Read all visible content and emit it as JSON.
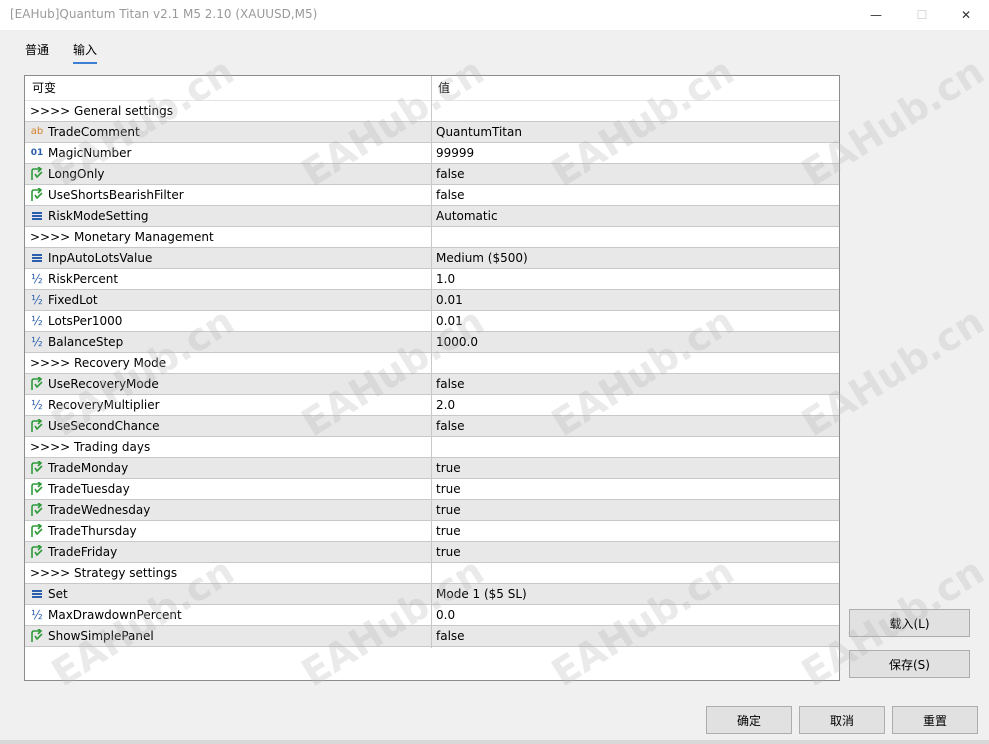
{
  "window": {
    "title": "[EAHub]Quantum Titan v2.1 M5 2.10 (XAUUSD,M5)",
    "minimize_glyph": "—",
    "maximize_glyph": "☐",
    "close_glyph": "✕"
  },
  "tabs": [
    {
      "label": "普通",
      "active": false
    },
    {
      "label": "输入",
      "active": true
    }
  ],
  "grid": {
    "columns": [
      "可变",
      "值"
    ],
    "rows": [
      {
        "type": "section",
        "name": ">>>> General settings",
        "value": ""
      },
      {
        "type": "param",
        "icon": "text-param-icon",
        "glyph": "ab",
        "name": "TradeComment",
        "value": "QuantumTitan"
      },
      {
        "type": "param",
        "icon": "integer-param-icon",
        "glyph": "01",
        "name": "MagicNumber",
        "value": "99999"
      },
      {
        "type": "param",
        "icon": "bool-param-icon",
        "glyph": "",
        "name": "LongOnly",
        "value": "false"
      },
      {
        "type": "param",
        "icon": "bool-param-icon",
        "glyph": "",
        "name": "UseShortsBearishFilter",
        "value": "false"
      },
      {
        "type": "param",
        "icon": "enum-param-icon",
        "glyph": "",
        "name": "RiskModeSetting",
        "value": "Automatic"
      },
      {
        "type": "section",
        "name": ">>>> Monetary Management",
        "value": ""
      },
      {
        "type": "param",
        "icon": "enum-param-icon",
        "glyph": "",
        "name": "InpAutoLotsValue",
        "value": "Medium ($500)"
      },
      {
        "type": "param",
        "icon": "double-param-icon",
        "glyph": "½",
        "name": "RiskPercent",
        "value": "1.0"
      },
      {
        "type": "param",
        "icon": "double-param-icon",
        "glyph": "½",
        "name": "FixedLot",
        "value": "0.01"
      },
      {
        "type": "param",
        "icon": "double-param-icon",
        "glyph": "½",
        "name": "LotsPer1000",
        "value": "0.01"
      },
      {
        "type": "param",
        "icon": "double-param-icon",
        "glyph": "½",
        "name": "BalanceStep",
        "value": "1000.0"
      },
      {
        "type": "section",
        "name": ">>>> Recovery Mode",
        "value": ""
      },
      {
        "type": "param",
        "icon": "bool-param-icon",
        "glyph": "",
        "name": "UseRecoveryMode",
        "value": "false"
      },
      {
        "type": "param",
        "icon": "double-param-icon",
        "glyph": "½",
        "name": "RecoveryMultiplier",
        "value": "2.0"
      },
      {
        "type": "param",
        "icon": "bool-param-icon",
        "glyph": "",
        "name": "UseSecondChance",
        "value": "false"
      },
      {
        "type": "section",
        "name": ">>>> Trading days",
        "value": ""
      },
      {
        "type": "param",
        "icon": "bool-param-icon",
        "glyph": "",
        "name": "TradeMonday",
        "value": "true"
      },
      {
        "type": "param",
        "icon": "bool-param-icon",
        "glyph": "",
        "name": "TradeTuesday",
        "value": "true"
      },
      {
        "type": "param",
        "icon": "bool-param-icon",
        "glyph": "",
        "name": "TradeWednesday",
        "value": "true"
      },
      {
        "type": "param",
        "icon": "bool-param-icon",
        "glyph": "",
        "name": "TradeThursday",
        "value": "true"
      },
      {
        "type": "param",
        "icon": "bool-param-icon",
        "glyph": "",
        "name": "TradeFriday",
        "value": "true"
      },
      {
        "type": "section",
        "name": ">>>> Strategy settings",
        "value": ""
      },
      {
        "type": "param",
        "icon": "enum-param-icon",
        "glyph": "",
        "name": "Set",
        "value": "Mode 1 ($5 SL)"
      },
      {
        "type": "param",
        "icon": "double-param-icon",
        "glyph": "½",
        "name": "MaxDrawdownPercent",
        "value": "0.0"
      },
      {
        "type": "param",
        "icon": "bool-param-icon",
        "glyph": "",
        "name": "ShowSimplePanel",
        "value": "false"
      }
    ]
  },
  "buttons": {
    "load": "载入(L)",
    "save": "保存(S)",
    "ok": "确定",
    "cancel": "取消",
    "reset": "重置"
  },
  "watermark": "EAHub.cn",
  "colors": {
    "bool_icon": "#2f9a3a",
    "enum_icon": "#2b5fae",
    "text_icon": "#d4822b",
    "tab_underline": "#3d7fd0"
  }
}
